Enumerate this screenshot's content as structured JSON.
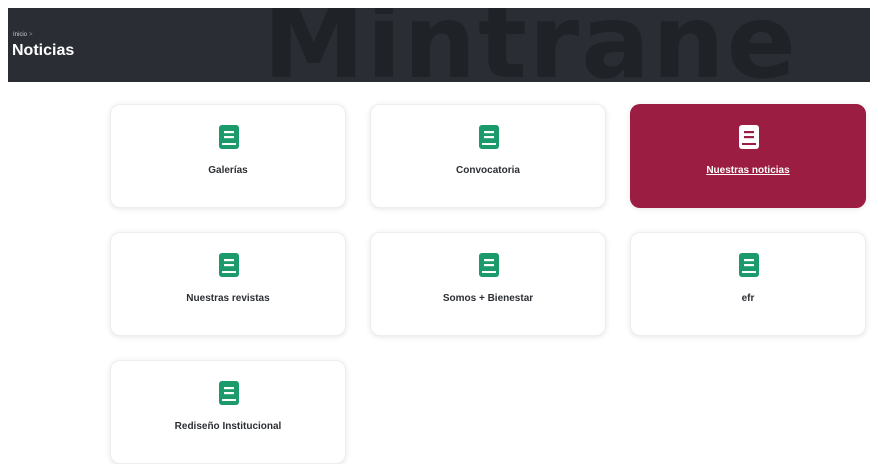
{
  "header": {
    "breadcrumb": "Inicio",
    "breadcrumb_separator": ">",
    "title": "Noticias",
    "watermark": "Mintrane"
  },
  "colors": {
    "icon_green": "#1b9a6b",
    "active_card": "#9b1d42",
    "banner": "#2a2d33"
  },
  "cards": [
    {
      "label": "Galerías",
      "icon": "book-icon",
      "active": false
    },
    {
      "label": "Convocatoria",
      "icon": "book-icon",
      "active": false
    },
    {
      "label": "Nuestras noticias",
      "icon": "book-icon",
      "active": true
    },
    {
      "label": "Nuestras revistas",
      "icon": "book-icon",
      "active": false
    },
    {
      "label": "Somos + Bienestar",
      "icon": "book-icon",
      "active": false
    },
    {
      "label": "efr",
      "icon": "book-icon",
      "active": false
    },
    {
      "label": "Rediseño Institucional",
      "icon": "book-icon",
      "active": false
    }
  ]
}
